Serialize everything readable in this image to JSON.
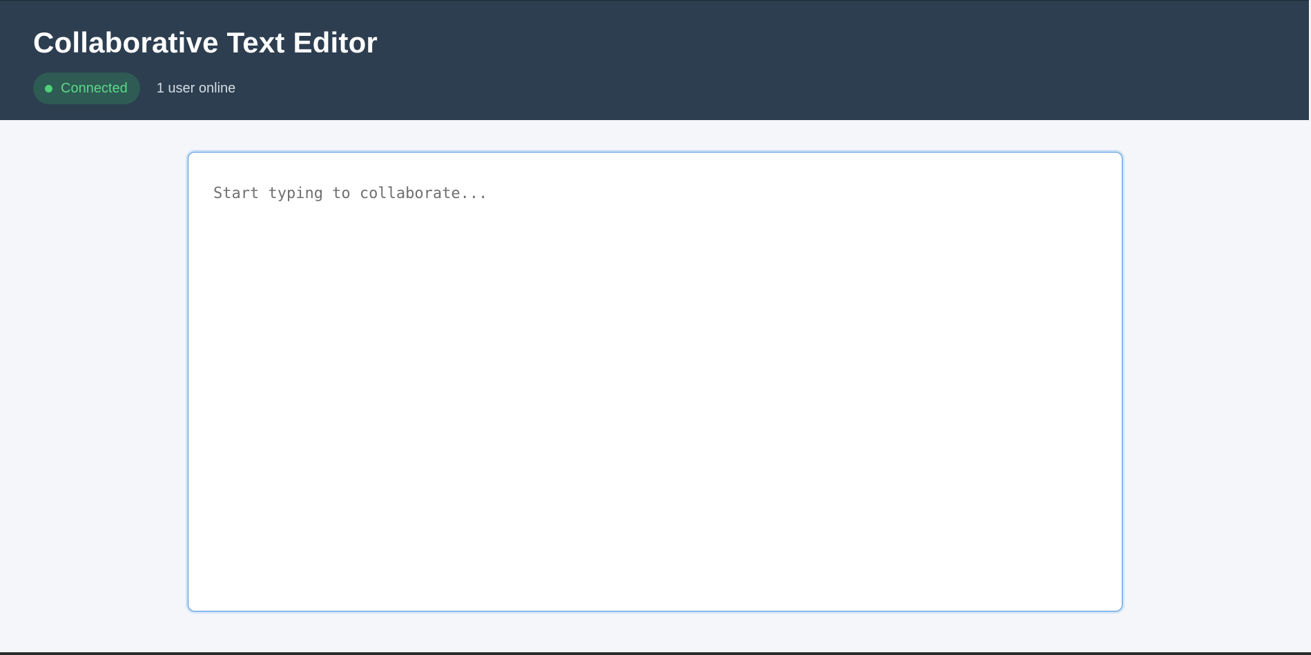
{
  "header": {
    "title": "Collaborative Text Editor",
    "status": {
      "label": "Connected",
      "icon": "status-dot-icon",
      "color": "#4fd07a"
    },
    "users_online": "1 user online"
  },
  "editor": {
    "value": "",
    "placeholder": "Start typing to collaborate..."
  },
  "colors": {
    "header_bg": "#2d3e50",
    "page_bg": "#f4f6fa",
    "accent_border": "#4a90d9",
    "status_badge_bg": "#2e5b53"
  }
}
